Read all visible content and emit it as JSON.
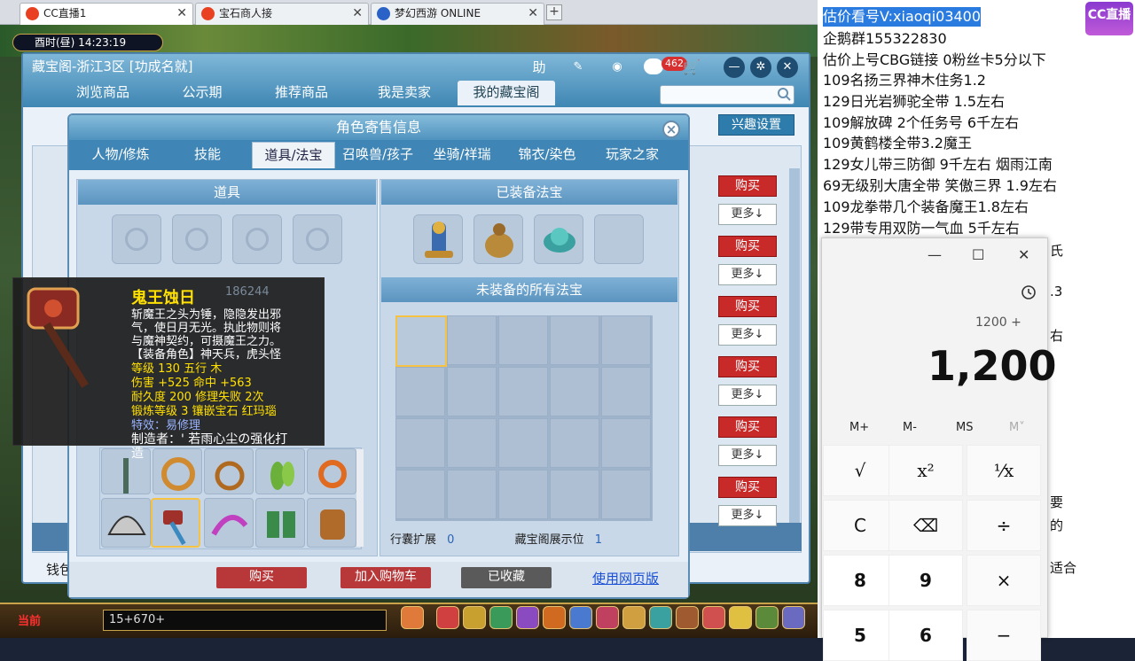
{
  "browser": {
    "tabs": [
      {
        "title": "CC直播1",
        "color": "#e84020"
      },
      {
        "title": "宝石商人接",
        "color": "#e84020"
      },
      {
        "title": "梦幻西游 ONLINE",
        "color": "#2a62c8"
      }
    ],
    "new_tab": "+",
    "close_glyph": "✕"
  },
  "game": {
    "clock": "酉时(昼)  14:23:19",
    "now_label": "当前",
    "chat_input": "15+670+"
  },
  "cbg": {
    "title": "藏宝阁-浙江3区 [功成名就]",
    "help_button": "助",
    "cart_count": "462",
    "nav_tabs": [
      "浏览商品",
      "公示期",
      "推荐商品",
      "我是卖家",
      "我的藏宝阁"
    ],
    "interest_button": "兴趣设置",
    "money_label": "钱包",
    "list_buttons": {
      "buy": "购买",
      "more": "更多↓"
    }
  },
  "dialog": {
    "title": "角色寄售信息",
    "tabs": [
      "人物/修炼",
      "技能",
      "道具/法宝",
      "召唤兽/孩子",
      "坐骑/祥瑞",
      "锦衣/染色",
      "玩家之家"
    ],
    "active_tab": "道具/法宝",
    "items_header": "道具",
    "equipped_header": "已装备法宝",
    "unequipped_header": "未装备的所有法宝",
    "bag_expand_label": "行囊扩展",
    "bag_expand_value": "0",
    "display_label": "藏宝阁展示位",
    "display_value": "1",
    "buttons": {
      "buy": "购买",
      "add_cart": "加入购物车",
      "collected": "已收藏",
      "web": "使用网页版"
    }
  },
  "tooltip": {
    "name": "鬼王蚀日",
    "bg_number": "186244",
    "desc1": "斩魔王之头为锤，隐隐发出邪",
    "desc2": "气，使日月无光。执此物则将",
    "desc3": "与魔神契约，可摄魔王之力。",
    "role": "【装备角色】神天兵，虎头怪",
    "level": "等级 130  五行 木",
    "damage": "伤害 +525 命中 +563",
    "durability": "耐久度 200  修理失败 2次",
    "forge": "锻炼等级 3  镶嵌宝石 红玛瑙",
    "effect": "特效：易修理",
    "maker": "制造者：' 若雨心尘の强化打",
    "maker2": "造"
  },
  "overlay": {
    "lines": [
      "估价看号V:xiaoqi03400",
      "企鹅群155322830",
      "估价上号CBG链接  0粉丝卡5分以下",
      "109名扬三界神木住务1.2",
      "129日光岩狮驼全带  1.5左右",
      "109解放碑 2个任务号 6千左右",
      "109黄鹤楼全带3.2魔王",
      "129女儿带三防御 9千左右 烟雨江南",
      "69无级别大唐全带  笑傲三界 1.9左右",
      "109龙拳带几个装备魔王1.8左右",
      "129带专用双防一气血 5千左右"
    ],
    "logo": "CC直播",
    "peek": [
      "氏",
      ".3",
      "右",
      "适合",
      "的",
      "要"
    ]
  },
  "calculator": {
    "win_buttons": [
      "—",
      "☐",
      "✕"
    ],
    "expression": "1200 +",
    "display": "1,200",
    "memory": [
      "M+",
      "M-",
      "MS",
      "M˅"
    ],
    "keys": [
      [
        "√",
        "x²",
        "¹⁄x"
      ],
      [
        "C",
        "⌫",
        "÷"
      ],
      [
        "8",
        "9",
        "×"
      ],
      [
        "5",
        "6",
        ""
      ]
    ]
  }
}
